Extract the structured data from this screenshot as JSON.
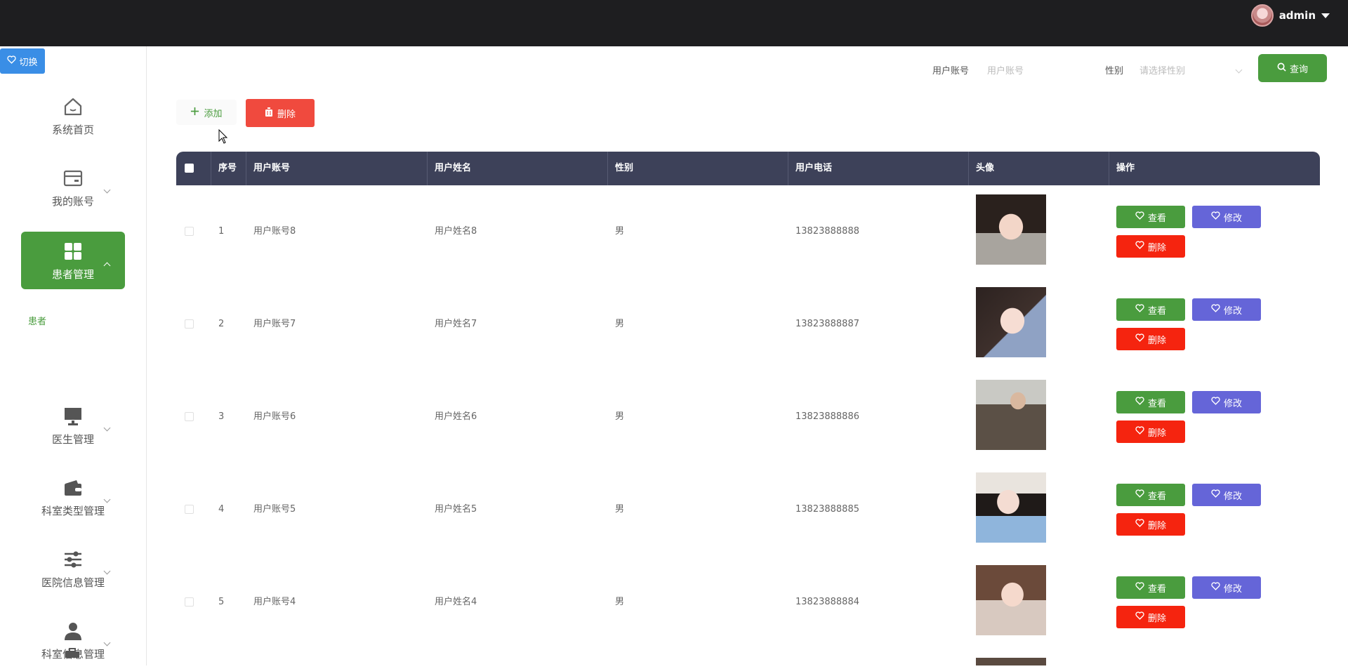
{
  "header": {
    "username": "admin"
  },
  "switch_label": "切换",
  "sidebar": {
    "items": [
      {
        "label": "系统首页",
        "icon": "home-icon"
      },
      {
        "label": "我的账号",
        "icon": "card-icon"
      },
      {
        "label": "患者管理",
        "icon": "grid-icon",
        "active": true
      },
      {
        "label": "医生管理",
        "icon": "monitor-icon"
      },
      {
        "label": "科室类型管理",
        "icon": "wallet-icon"
      },
      {
        "label": "医院信息管理",
        "icon": "sliders-icon"
      },
      {
        "label": "科室信息管理",
        "icon": "user-icon"
      }
    ],
    "sub_item": "患者"
  },
  "search": {
    "account_label": "用户账号",
    "account_placeholder": "用户账号",
    "gender_label": "性别",
    "gender_placeholder": "请选择性别",
    "query_label": "查询"
  },
  "toolbar": {
    "add_label": "添加",
    "delete_label": "删除"
  },
  "table": {
    "headers": [
      "序号",
      "用户账号",
      "用户姓名",
      "性别",
      "用户电话",
      "头像",
      "操作"
    ],
    "rows": [
      {
        "index": "1",
        "account": "用户账号8",
        "name": "用户姓名8",
        "gender": "男",
        "phone": "13823888888"
      },
      {
        "index": "2",
        "account": "用户账号7",
        "name": "用户姓名7",
        "gender": "男",
        "phone": "13823888887"
      },
      {
        "index": "3",
        "account": "用户账号6",
        "name": "用户姓名6",
        "gender": "男",
        "phone": "13823888886"
      },
      {
        "index": "4",
        "account": "用户账号5",
        "name": "用户姓名5",
        "gender": "男",
        "phone": "13823888885"
      },
      {
        "index": "5",
        "account": "用户账号4",
        "name": "用户姓名4",
        "gender": "男",
        "phone": "13823888884"
      }
    ],
    "actions": {
      "view": "查看",
      "edit": "修改",
      "delete": "删除"
    }
  },
  "colors": {
    "topbar": "#1e1e20",
    "accent_green": "#4a9c3e",
    "danger_red": "#f5240f",
    "edit_purple": "#6565d8",
    "table_header": "#3d4159",
    "switch_blue": "#3a8ee6"
  }
}
